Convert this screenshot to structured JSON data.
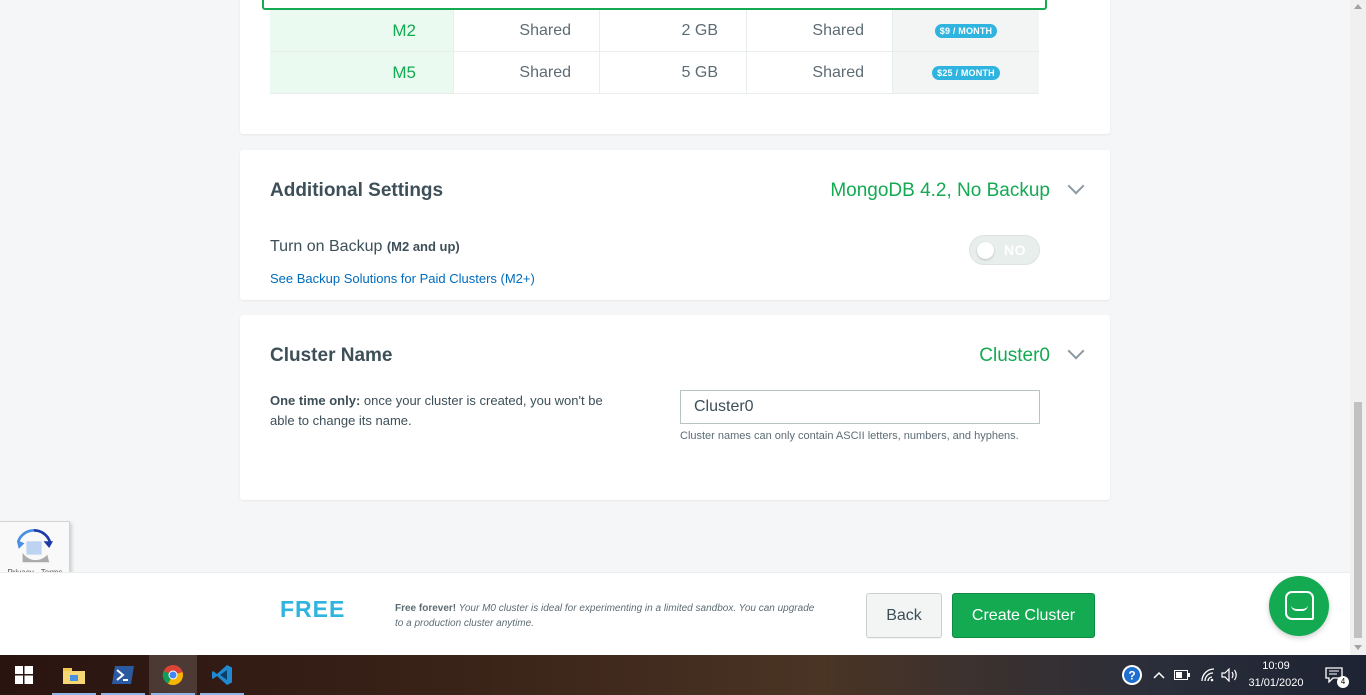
{
  "tiers": [
    {
      "name": "M2",
      "ram": "Shared",
      "storage": "2 GB",
      "cpu": "Shared",
      "price": "$9 / MONTH"
    },
    {
      "name": "M5",
      "ram": "Shared",
      "storage": "5 GB",
      "cpu": "Shared",
      "price": "$25 / MONTH"
    }
  ],
  "additional_settings": {
    "title": "Additional Settings",
    "summary": "MongoDB 4.2, No Backup",
    "backup_label": "Turn on Backup",
    "backup_qualifier": "(M2 and up)",
    "backup_toggle": "NO",
    "backup_link": "See Backup Solutions for Paid Clusters (M2+)"
  },
  "cluster_name": {
    "title": "Cluster Name",
    "summary": "Cluster0",
    "note_bold": "One time only:",
    "note_text": " once your cluster is created, you won't be able to change its name.",
    "input_value": "Cluster0",
    "help": "Cluster names can only contain ASCII letters, numbers, and hyphens."
  },
  "recaptcha": {
    "links": "Privacy - Terms"
  },
  "footer": {
    "tier_label": "FREE",
    "note_bold": "Free forever!",
    "note_text": " Your M0 cluster is ideal for experimenting in a limited sandbox. You can upgrade to a production cluster anytime.",
    "back_label": "Back",
    "create_label": "Create Cluster"
  },
  "taskbar": {
    "time": "10:09",
    "date": "31/01/2020",
    "notification_count": "4"
  },
  "colors": {
    "accent_green": "#13aa52",
    "accent_blue": "#2fb4e0",
    "link_blue": "#006cbc"
  }
}
